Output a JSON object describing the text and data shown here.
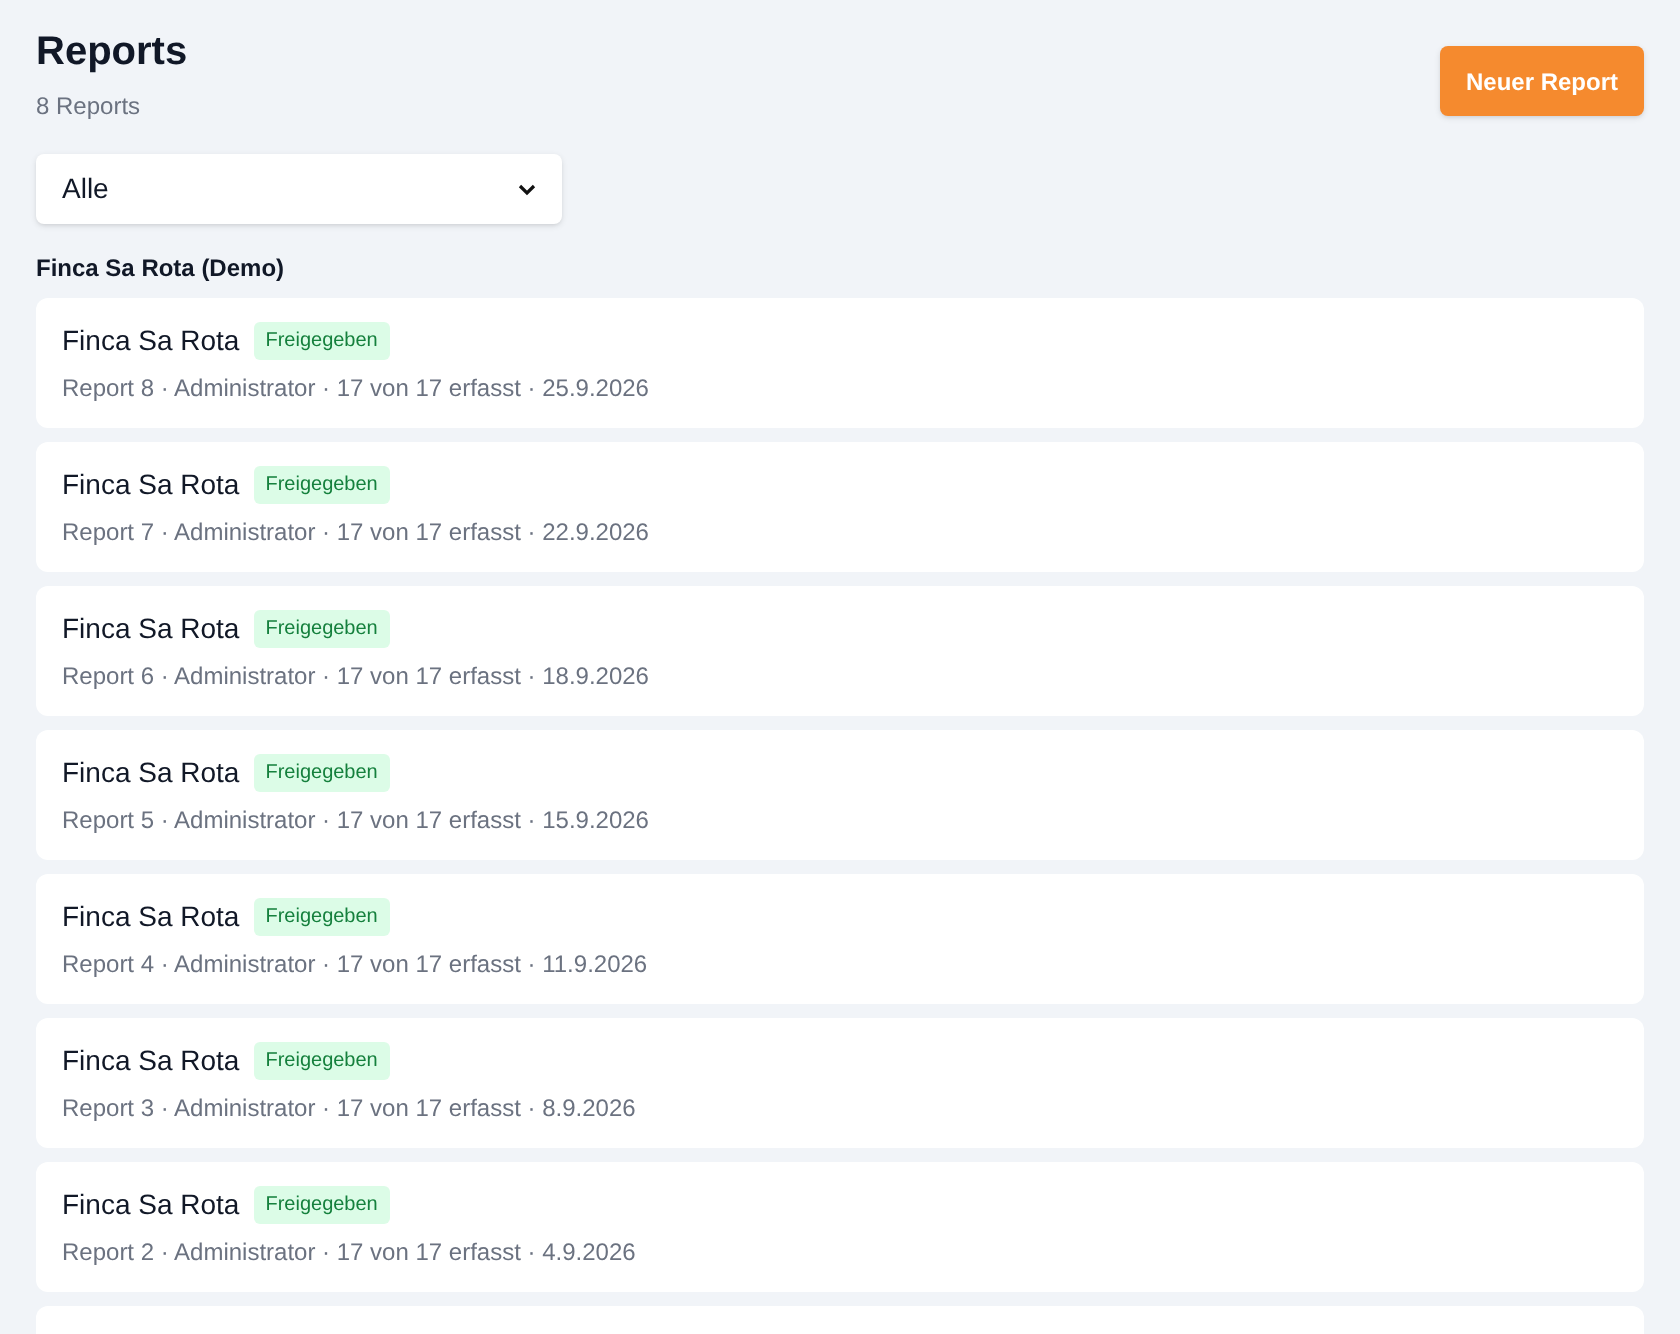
{
  "header": {
    "title": "Reports",
    "count": "8 Reports",
    "new_button": "Neuer Report"
  },
  "filter": {
    "value": "Alle"
  },
  "group": {
    "title": "Finca Sa Rota (Demo)",
    "reports": [
      {
        "title": "Finca Sa Rota",
        "badge": "Freigegeben",
        "meta": "Report 8 · Administrator · 17 von 17 erfasst · 25.9.2026"
      },
      {
        "title": "Finca Sa Rota",
        "badge": "Freigegeben",
        "meta": "Report 7 · Administrator · 17 von 17 erfasst · 22.9.2026"
      },
      {
        "title": "Finca Sa Rota",
        "badge": "Freigegeben",
        "meta": "Report 6 · Administrator · 17 von 17 erfasst · 18.9.2026"
      },
      {
        "title": "Finca Sa Rota",
        "badge": "Freigegeben",
        "meta": "Report 5 · Administrator · 17 von 17 erfasst · 15.9.2026"
      },
      {
        "title": "Finca Sa Rota",
        "badge": "Freigegeben",
        "meta": "Report 4 · Administrator · 17 von 17 erfasst · 11.9.2026"
      },
      {
        "title": "Finca Sa Rota",
        "badge": "Freigegeben",
        "meta": "Report 3 · Administrator · 17 von 17 erfasst · 8.9.2026"
      },
      {
        "title": "Finca Sa Rota",
        "badge": "Freigegeben",
        "meta": "Report 2 · Administrator · 17 von 17 erfasst · 4.9.2026"
      }
    ]
  }
}
